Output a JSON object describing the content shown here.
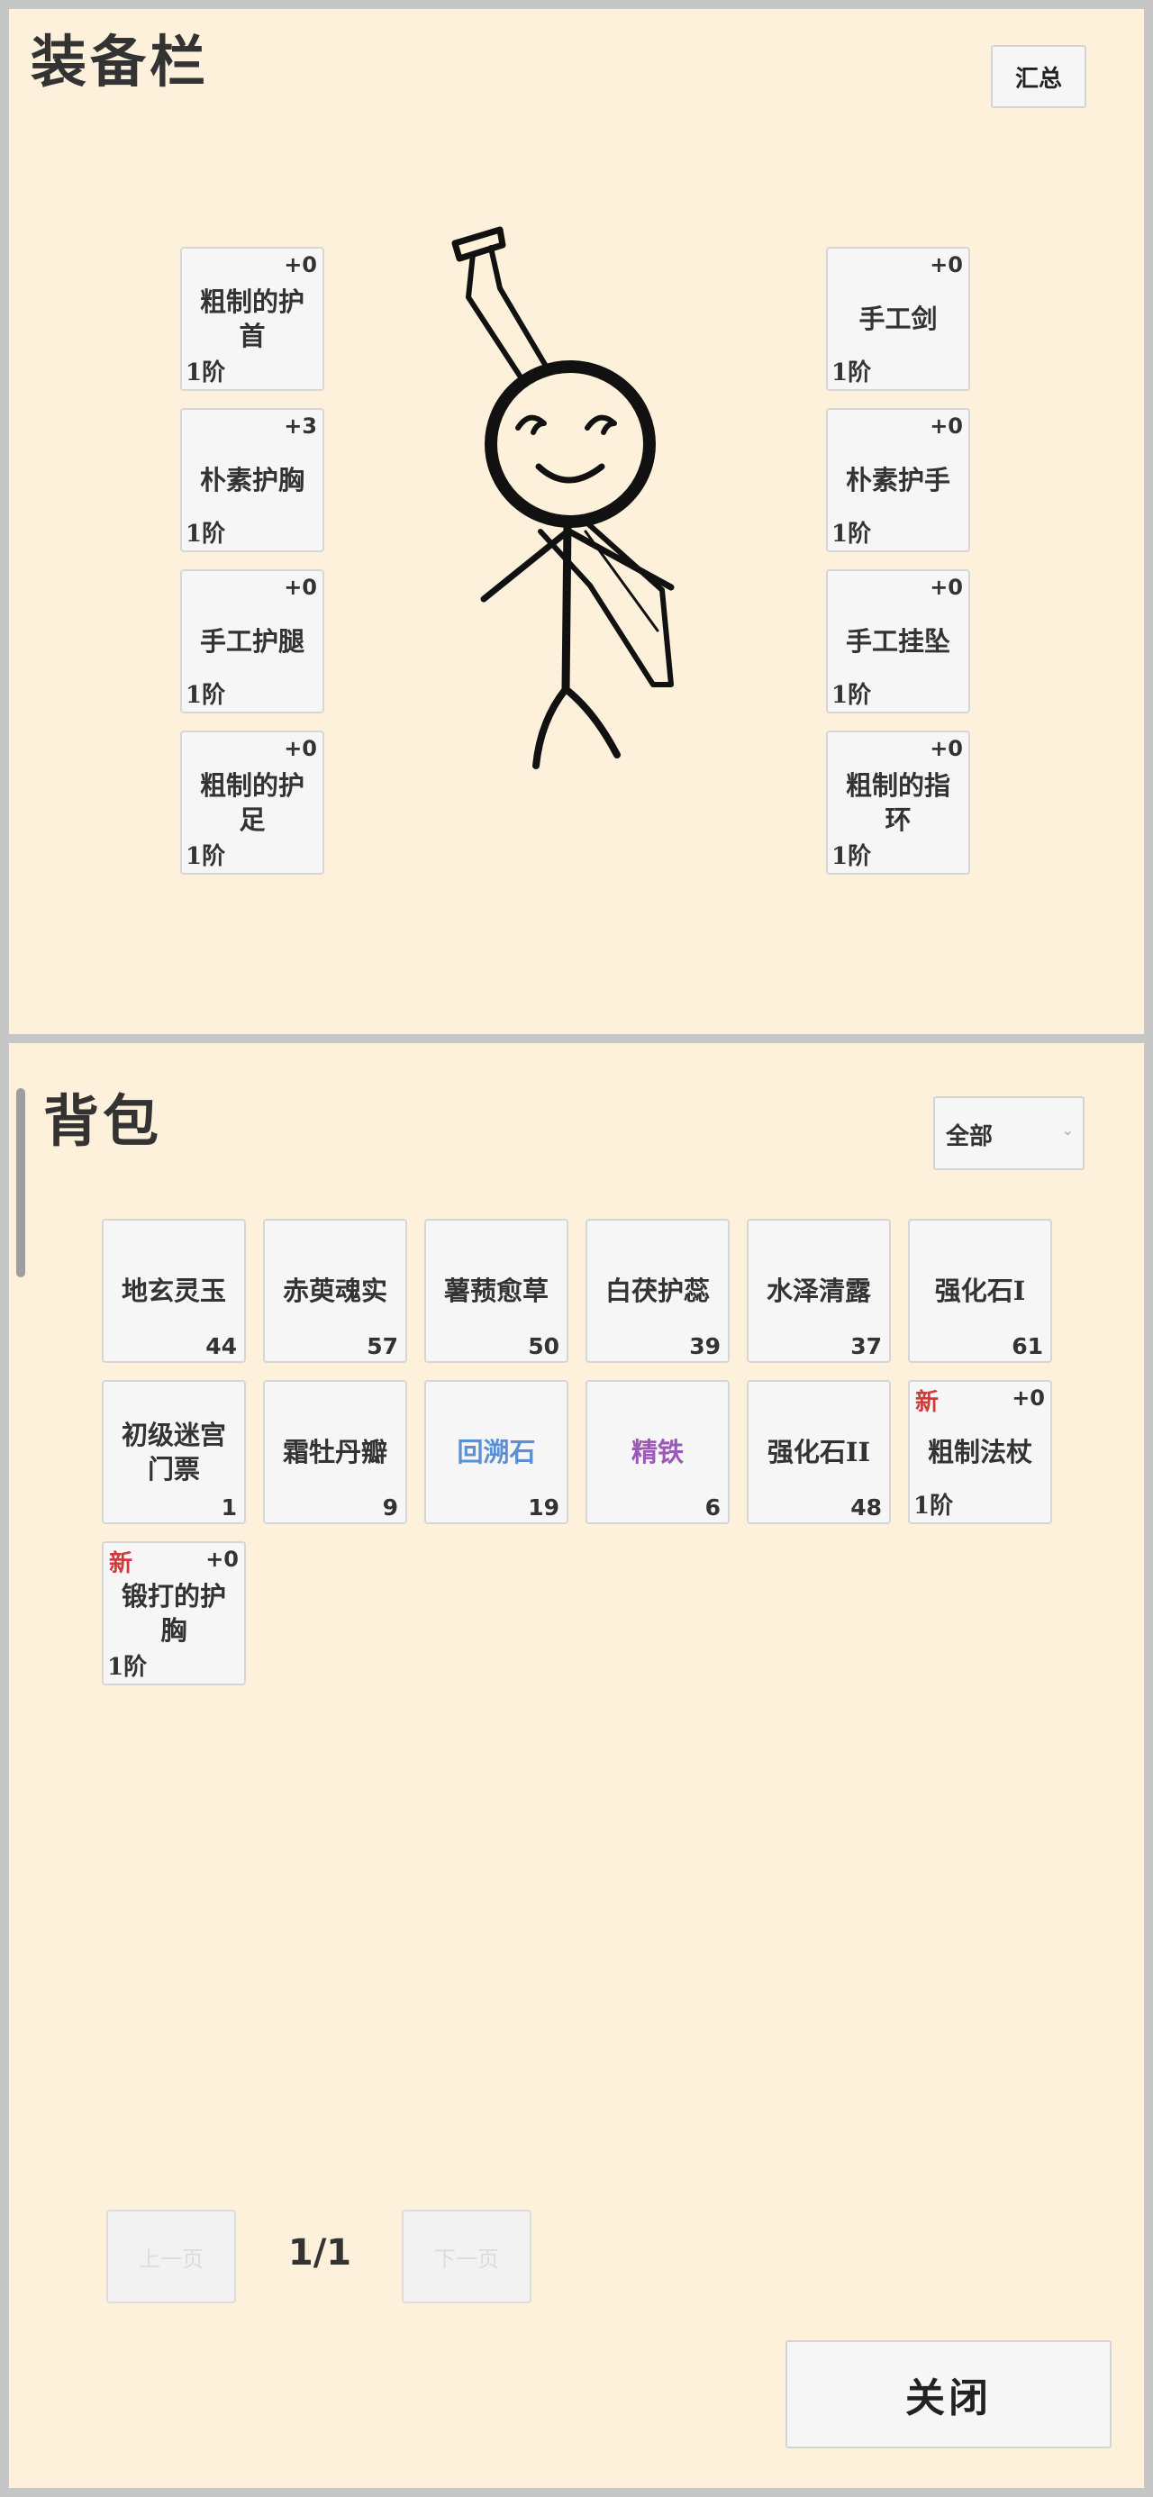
{
  "equipment": {
    "title": "装备栏",
    "summary_label": "汇总",
    "left_slots": [
      {
        "name": "粗制的护首",
        "level": "+0",
        "tier": "1阶"
      },
      {
        "name": "朴素护胸",
        "level": "+3",
        "tier": "1阶"
      },
      {
        "name": "手工护腿",
        "level": "+0",
        "tier": "1阶"
      },
      {
        "name": "粗制的护足",
        "level": "+0",
        "tier": "1阶"
      }
    ],
    "right_slots": [
      {
        "name": "手工剑",
        "level": "+0",
        "tier": "1阶"
      },
      {
        "name": "朴素护手",
        "level": "+0",
        "tier": "1阶"
      },
      {
        "name": "手工挂坠",
        "level": "+0",
        "tier": "1阶"
      },
      {
        "name": "粗制的指环",
        "level": "+0",
        "tier": "1阶"
      }
    ]
  },
  "bag": {
    "title": "背包",
    "filter": {
      "selected": "全部"
    },
    "items": [
      {
        "name": "地玄灵玉",
        "count": "44",
        "color": "#333333"
      },
      {
        "name": "赤萸魂实",
        "count": "57",
        "color": "#333333"
      },
      {
        "name": "薯蓣愈草",
        "count": "50",
        "color": "#333333"
      },
      {
        "name": "白茯护蕊",
        "count": "39",
        "color": "#333333"
      },
      {
        "name": "水泽清露",
        "count": "37",
        "color": "#333333"
      },
      {
        "name": "强化石I",
        "count": "61",
        "color": "#333333"
      },
      {
        "name": "初级迷宫门票",
        "count": "1",
        "color": "#333333"
      },
      {
        "name": "霜牡丹瓣",
        "count": "9",
        "color": "#333333"
      },
      {
        "name": "回溯石",
        "count": "19",
        "color": "#5b8fd6"
      },
      {
        "name": "精铁",
        "count": "6",
        "color": "#9b59b6"
      },
      {
        "name": "强化石II",
        "count": "48",
        "color": "#333333"
      },
      {
        "name": "粗制法杖",
        "new": "新",
        "level": "+0",
        "tier": "1阶",
        "color": "#333333"
      },
      {
        "name": "锻打的护胸",
        "new": "新",
        "level": "+0",
        "tier": "1阶",
        "color": "#333333"
      }
    ]
  },
  "pagination": {
    "prev_label": "上一页",
    "next_label": "下一页",
    "page": "1/1"
  },
  "close_label": "关闭"
}
